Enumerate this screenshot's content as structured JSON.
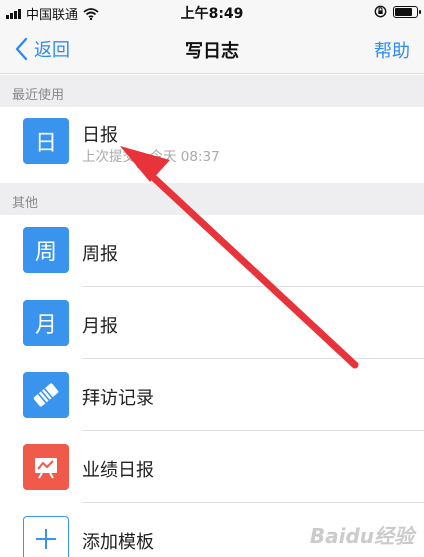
{
  "status_bar": {
    "carrier": "中国联通",
    "time": "上午8:49",
    "wifi_icon": "wifi-icon",
    "lock_icon": "orientation-lock-icon",
    "battery_level": 0.85
  },
  "nav": {
    "back_label": "返回",
    "title": "写日志",
    "help_label": "帮助"
  },
  "sections": {
    "recent": {
      "header": "最近使用",
      "items": [
        {
          "icon_text": "日",
          "title": "日报",
          "subtitle": "上次提交：今天 08:37"
        }
      ]
    },
    "other": {
      "header": "其他",
      "items": [
        {
          "icon_text": "周",
          "title": "周报"
        },
        {
          "icon_text": "月",
          "title": "月报"
        },
        {
          "icon": "handshake-icon",
          "title": "拜访记录"
        },
        {
          "icon": "chart-trend-icon",
          "title": "业绩日报"
        },
        {
          "icon": "plus-icon",
          "title": "添加模板"
        }
      ]
    }
  },
  "colors": {
    "accent": "#2f8bf0",
    "icon_blue": "#3a94ee",
    "icon_red": "#ef5a4a",
    "annotation_arrow": "#e8333a"
  },
  "watermark": "Baidu经验"
}
